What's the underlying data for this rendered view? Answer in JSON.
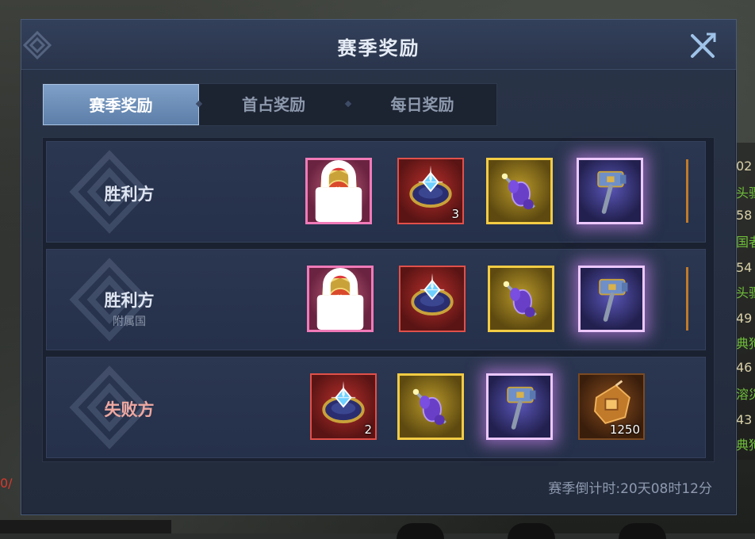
{
  "background": {
    "right_lines": [
      {
        "text": "02",
        "tone": "plain"
      },
      {
        "text": "头骤",
        "tone": "green"
      },
      {
        "text": "58",
        "tone": "plain"
      },
      {
        "text": "国者",
        "tone": "green"
      },
      {
        "text": "54",
        "tone": "plain"
      },
      {
        "text": "头骤",
        "tone": "green"
      },
      {
        "text": "49",
        "tone": "plain"
      },
      {
        "text": "典狗",
        "tone": "green"
      },
      {
        "text": "46",
        "tone": "plain"
      },
      {
        "text": "溶災",
        "tone": "green"
      },
      {
        "text": "43",
        "tone": "plain"
      },
      {
        "text": "典狗",
        "tone": "green"
      }
    ],
    "left_red": "0/"
  },
  "modal": {
    "title": "赛季奖励",
    "tabs": [
      {
        "label": "赛季奖励",
        "active": true
      },
      {
        "label": "首占奖励",
        "active": false
      },
      {
        "label": "每日奖励",
        "active": false
      }
    ],
    "rows": [
      {
        "label": "胜利方",
        "sublabel": "",
        "items": [
          {
            "icon": "title-badge-icon",
            "rarity": "pink",
            "count": "",
            "locked": true
          },
          {
            "icon": "gem-ring-icon",
            "rarity": "red",
            "count": "3",
            "locked": false
          },
          {
            "icon": "purple-flask-icon",
            "rarity": "gold",
            "count": "",
            "locked": false
          },
          {
            "icon": "hammer-icon",
            "rarity": "purple",
            "count": "",
            "locked": false
          }
        ]
      },
      {
        "label": "胜利方",
        "sublabel": "附属国",
        "items": [
          {
            "icon": "title-badge-icon",
            "rarity": "pink",
            "count": "",
            "locked": true
          },
          {
            "icon": "gem-ring-icon",
            "rarity": "red",
            "count": "",
            "locked": false
          },
          {
            "icon": "purple-flask-icon",
            "rarity": "gold",
            "count": "",
            "locked": false
          },
          {
            "icon": "hammer-icon",
            "rarity": "purple",
            "count": "",
            "locked": false
          }
        ]
      },
      {
        "label": "失败方",
        "sublabel": "",
        "items": [
          {
            "icon": "gem-ring-icon",
            "rarity": "red",
            "count": "2",
            "locked": false
          },
          {
            "icon": "purple-flask-icon",
            "rarity": "gold",
            "count": "",
            "locked": false
          },
          {
            "icon": "hammer-icon",
            "rarity": "purple",
            "count": "",
            "locked": false
          },
          {
            "icon": "orange-crystal-icon",
            "rarity": "orange",
            "count": "1250",
            "locked": false
          }
        ]
      }
    ],
    "countdown": "赛季倒计时:20天08时12分"
  }
}
